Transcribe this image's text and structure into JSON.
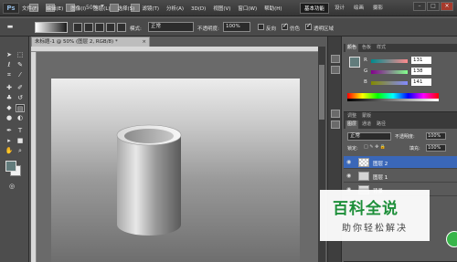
{
  "app": {
    "logo": "Ps",
    "zoom": "50%"
  },
  "menu": [
    "文件(F)",
    "编辑(E)",
    "图像(I)",
    "图层(L)",
    "选择(S)",
    "滤镜(T)",
    "分析(A)",
    "3D(D)",
    "视图(V)",
    "窗口(W)",
    "帮助(H)"
  ],
  "workspaces": {
    "active": "基本功能",
    "items": [
      "设计",
      "绘画",
      "摄影"
    ]
  },
  "window_controls": [
    "–",
    "□",
    "×"
  ],
  "options": {
    "mode_label": "模式:",
    "mode_value": "正常",
    "opacity_label": "不透明度:",
    "opacity_value": "100%",
    "reverse_label": "反向",
    "dither_label": "仿色",
    "transparency_label": "透明区域"
  },
  "document": {
    "tab_title": "未标题-1 @ 50% (图层 2, RGB/8) *",
    "close": "×"
  },
  "color_panel": {
    "tabs": [
      "颜色",
      "色板",
      "样式"
    ],
    "r_label": "R",
    "g_label": "G",
    "b_label": "B",
    "r": "131",
    "g": "138",
    "b": "141",
    "foreground": "#627c7c"
  },
  "layers_panel": {
    "tabs": [
      "图层",
      "通道",
      "路径"
    ],
    "adjust_tabs": [
      "调整",
      "蒙版"
    ],
    "blend_mode": "正常",
    "opacity_label": "不透明度:",
    "opacity_value": "100%",
    "lock_label": "锁定:",
    "fill_label": "填充:",
    "fill_value": "100%",
    "layers": [
      {
        "name": "图层 2",
        "selected": true
      },
      {
        "name": "图层 1",
        "selected": false
      },
      {
        "name": "背景",
        "selected": false
      }
    ]
  },
  "watermark": {
    "title": "百科全说",
    "subtitle": "助你轻松解决"
  }
}
